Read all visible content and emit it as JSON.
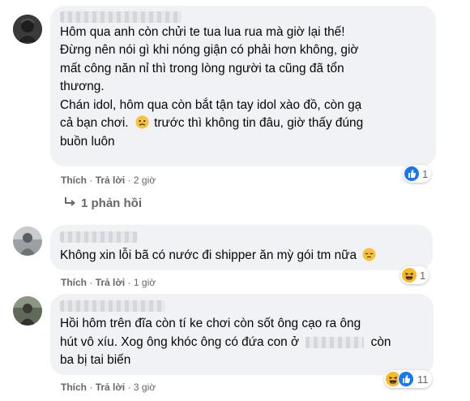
{
  "comments": [
    {
      "lines": [
        "Hôm qua anh còn chửi te tua lua rua mà giờ lại thế!",
        "Đừng nên nói gì khi nóng giận có phải hơn không, giờ",
        "mất công năn nỉ thì trong lòng người ta cũng đã tổn",
        "thương.",
        "Chán idol, hôm qua còn bắt tận tay idol xào đồ, còn gạ",
        "cả bạn chơi.",
        " trước thì không tin đâu, giờ thấy đúng",
        "buồn luôn"
      ],
      "like": "Thích",
      "reply": "Trả lời",
      "time": "2 giờ",
      "reaction_count": "1",
      "reaction_icons": [
        "like-icon"
      ]
    },
    {
      "lines": [
        "Không xin lỗi bã có nước đi shipper ăn mỳ gói tm nữa"
      ],
      "like": "Thích",
      "reply": "Trả lời",
      "time": "1 giờ",
      "reaction_count": "1",
      "reaction_icons": [
        "haha-icon"
      ]
    },
    {
      "lines": [
        "Hồi hôm trên đĩa còn tí ke chơi còn sốt ông cạo ra ông",
        "hút vô xíu. Xog ông khóc ông có đứa con ở",
        "còn",
        "ba bị tai biến"
      ],
      "like": "Thích",
      "reply": "Trả lời",
      "time": "3 giờ",
      "reaction_count": "11",
      "reaction_icons": [
        "haha-icon",
        "like-icon"
      ]
    }
  ],
  "replies": {
    "label": "1 phản hồi",
    "icon": "reply-arrow-icon"
  },
  "separator": "·",
  "colors": {
    "bubble": "#f0f2f5",
    "text": "#050505",
    "meta": "#65676b",
    "like_blue": "#1877f2",
    "haha_yellow": "#f7b928"
  }
}
